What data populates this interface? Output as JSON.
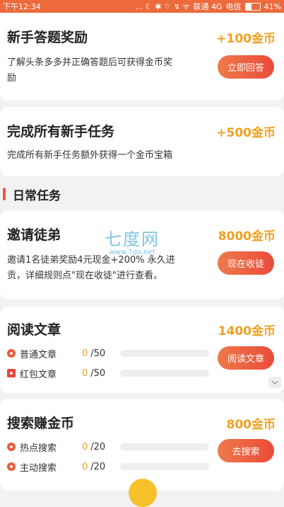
{
  "status_bar": {
    "time": "下午12:34",
    "icons_text": "... ☾ ✱ ⌔ ↯ ᯤ",
    "carrier1": "联通 4G",
    "carrier2": "电信",
    "battery": "41%"
  },
  "cards": {
    "quiz": {
      "title": "新手答题奖励",
      "reward": "+100金币",
      "desc_line1": "了解头条多多并正确答题后可获得金币奖",
      "desc_line2": "励",
      "button": "立即回答"
    },
    "newbie": {
      "title": "完成所有新手任务",
      "reward": "+500金币",
      "desc": "完成所有新手任务额外获得一个金币宝箱"
    },
    "invite": {
      "title": "邀请徒弟",
      "reward": "8000金币",
      "desc_line1": "邀请1名徒弟奖励4元现金+200% 永久进",
      "desc_line2": "贡，详细规则点\"现在收徒\"进行查看。",
      "button": "现在收徒"
    },
    "read": {
      "title": "阅读文章",
      "reward": "1400金币",
      "button": "阅读文章",
      "rows": [
        {
          "label": "普通文章",
          "count": "0",
          "total": "/50",
          "progress": 0
        },
        {
          "label": "红包文章",
          "count": "0",
          "total": "/50",
          "progress": 0
        }
      ]
    },
    "search": {
      "title": "搜索赚金币",
      "reward": "800金币",
      "button": "去搜索",
      "rows": [
        {
          "label": "热点搜索",
          "count": "0",
          "total": "/20",
          "progress": 0
        },
        {
          "label": "主动搜索",
          "count": "0",
          "total": "/20",
          "progress": 0
        }
      ]
    }
  },
  "section": {
    "label": "日常任务"
  },
  "watermark": {
    "big": "七度网",
    "small": "www.7do.net"
  },
  "colors": {
    "accent": "#ec6a3c",
    "reward": "#f0a020",
    "button_from": "#ef7a4a",
    "button_to": "#ea4a3a"
  }
}
